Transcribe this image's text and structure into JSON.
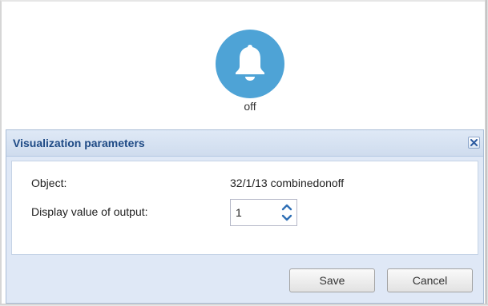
{
  "widget": {
    "icon": "bell-icon",
    "state_label": "off",
    "accent_color": "#4ea3d6"
  },
  "dialog": {
    "title": "Visualization parameters",
    "close_icon": "close-icon",
    "fields": {
      "object_label": "Object:",
      "object_value": "32/1/13 combinedonoff",
      "display_label": "Display value of output:",
      "display_value": "1"
    },
    "buttons": {
      "save_label": "Save",
      "cancel_label": "Cancel"
    }
  }
}
